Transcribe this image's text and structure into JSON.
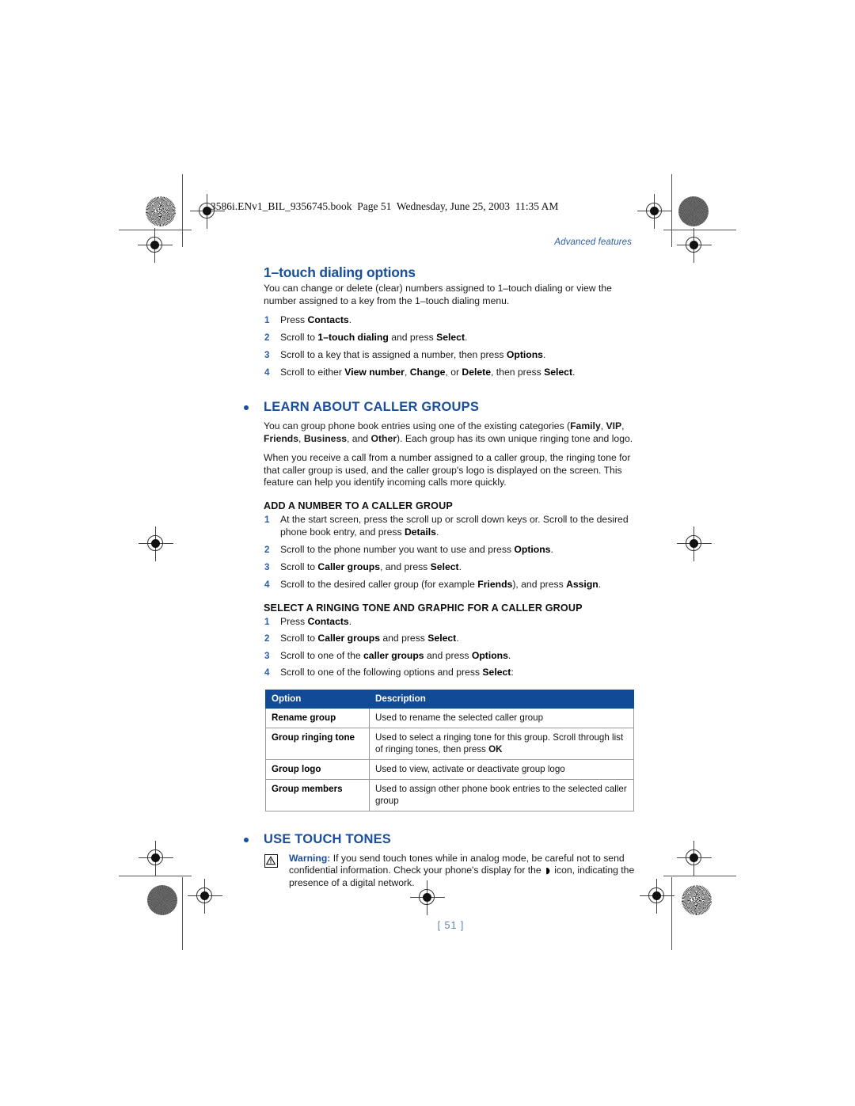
{
  "print_header": "3586i.ENv1_BIL_9356745.book  Page 51  Wednesday, June 25, 2003  11:35 AM",
  "running_head": "Advanced features",
  "folio": "[ 51 ]",
  "colors": {
    "heading_blue": "#1a4f9c",
    "accent_blue": "#2b5fa8",
    "table_header_bg": "#114a96",
    "folio_blue": "#5580b8",
    "body_text": "#1a1a1a"
  },
  "sections": {
    "one_touch": {
      "heading": "1–touch dialing options",
      "intro": "You can change or delete (clear) numbers assigned to 1–touch dialing or view the number assigned to a key from the 1–touch dialing menu.",
      "steps": [
        {
          "num": "1",
          "html": "Press <b>Contacts</b>."
        },
        {
          "num": "2",
          "html": "Scroll to <b>1–touch dialing</b> and press <b>Select</b>."
        },
        {
          "num": "3",
          "html": "Scroll to a key that is assigned a number, then press <b>Options</b>."
        },
        {
          "num": "4",
          "html": "Scroll to either <b>View number</b>, <b>Change</b>, or <b>Delete</b>, then press <b>Select</b>."
        }
      ]
    },
    "caller_groups": {
      "heading": "LEARN ABOUT CALLER GROUPS",
      "para1_html": "You can group phone book entries using one of the existing categories (<b>Family</b>, <b>VIP</b>, <b>Friends</b>, <b>Business</b>, and <b>Other</b>). Each group has its own unique ringing tone and logo.",
      "para2": "When you receive a call from a number assigned to a caller group, the ringing tone for that caller group is used, and the caller group's logo is displayed on the screen. This feature can help you identify incoming calls more quickly.",
      "add_number": {
        "heading": "ADD A NUMBER TO A CALLER GROUP",
        "steps": [
          {
            "num": "1",
            "html": "At the start screen, press the scroll up or scroll down keys or. Scroll to the desired phone book entry, and press <b>Details</b>."
          },
          {
            "num": "2",
            "html": "Scroll to the phone number you want to use and press <b>Options</b>."
          },
          {
            "num": "3",
            "html": "Scroll to <b>Caller groups</b>, and press <b>Select</b>."
          },
          {
            "num": "4",
            "html": "Scroll to the desired caller group (for example <b>Friends</b>), and press <b>Assign</b>."
          }
        ]
      },
      "ringing_tone": {
        "heading": "SELECT A RINGING TONE AND GRAPHIC FOR A CALLER GROUP",
        "steps": [
          {
            "num": "1",
            "html": "Press <b>Contacts</b>."
          },
          {
            "num": "2",
            "html": "Scroll to <b>Caller groups</b> and press <b>Select</b>."
          },
          {
            "num": "3",
            "html": "Scroll to one of the <b>caller groups</b> and press <b>Options</b>."
          },
          {
            "num": "4",
            "html": "Scroll to one of the following options and press <b>Select</b>:"
          }
        ]
      },
      "options_table": {
        "columns": [
          "Option",
          "Description"
        ],
        "rows": [
          {
            "option": "Rename group",
            "description_html": "Used to rename the selected caller group"
          },
          {
            "option": "Group ringing tone",
            "description_html": "Used to select a ringing tone for this group. Scroll through list of ringing tones, then press <b>OK</b>"
          },
          {
            "option": "Group logo",
            "description_html": "Used to view, activate or deactivate group logo"
          },
          {
            "option": "Group members",
            "description_html": "Used to assign other phone book entries to the selected caller group"
          }
        ]
      }
    },
    "touch_tones": {
      "heading": "USE TOUCH TONES",
      "warning_label": "Warning:",
      "warning_part1": " If you send touch tones while in analog mode, be careful not to send confidential information. Check your phone's display for the ",
      "warning_icon_glyph": "◗",
      "warning_part2": " icon, indicating the presence of a digital network."
    }
  }
}
